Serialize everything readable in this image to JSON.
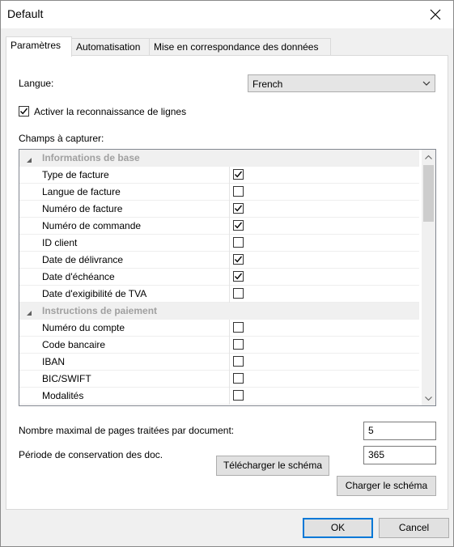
{
  "window": {
    "title": "Default"
  },
  "tabs": [
    {
      "label": "Paramètres"
    },
    {
      "label": "Automatisation"
    },
    {
      "label": "Mise en correspondance des données"
    }
  ],
  "settings": {
    "language_label": "Langue:",
    "language_value": "French",
    "line_recognition_label": "Activer la reconnaissance de lignes",
    "line_recognition_checked": true,
    "fields_label": "Champs à capturer:"
  },
  "fields": {
    "categories": [
      {
        "name": "Informations de base",
        "items": [
          {
            "name": "Type de facture",
            "checked": true
          },
          {
            "name": "Langue de facture",
            "checked": false
          },
          {
            "name": "Numéro de facture",
            "checked": true
          },
          {
            "name": "Numéro de commande",
            "checked": true
          },
          {
            "name": "ID client",
            "checked": false
          },
          {
            "name": "Date de délivrance",
            "checked": true
          },
          {
            "name": "Date d'échéance",
            "checked": true
          },
          {
            "name": "Date d'exigibilité de TVA",
            "checked": false
          }
        ]
      },
      {
        "name": "Instructions de paiement",
        "items": [
          {
            "name": "Numéro du compte",
            "checked": false
          },
          {
            "name": "Code bancaire",
            "checked": false
          },
          {
            "name": "IBAN",
            "checked": false
          },
          {
            "name": "BIC/SWIFT",
            "checked": false
          },
          {
            "name": "Modalités",
            "checked": false
          }
        ]
      }
    ]
  },
  "limits": {
    "max_pages_label": "Nombre maximal de pages traitées par document:",
    "max_pages_value": "5",
    "retention_label": "Période de conservation des doc.",
    "retention_value": "365"
  },
  "buttons": {
    "download_schema": "Télécharger le schéma",
    "load_schema": "Charger le schéma",
    "ok": "OK",
    "cancel": "Cancel"
  },
  "colors": {
    "accent": "#0078d7",
    "category_text": "#a0a0a0"
  }
}
